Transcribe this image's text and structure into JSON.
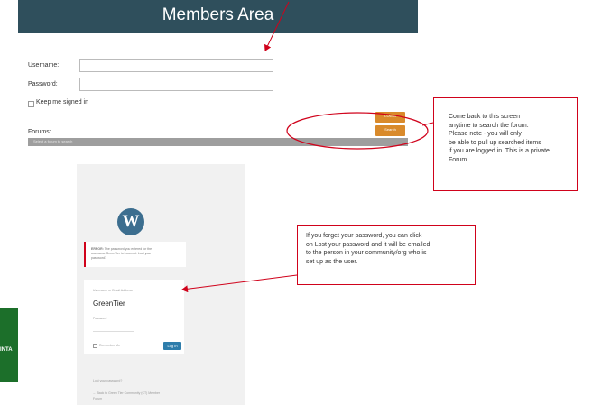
{
  "header": {
    "title": "Members Area"
  },
  "login_form": {
    "username_label": "Username:",
    "password_label": "Password:",
    "keep_signed_in_label": "Keep me signed in",
    "login_button": "LOGIN",
    "search_button": "Search"
  },
  "forums": {
    "label": "Forums:",
    "select_placeholder": "Select a forum to search"
  },
  "callout_search": {
    "lines": [
      "Come back to this screen",
      "anytime to search the forum.",
      "Please note - you will only",
      "be able to pull up searched items",
      "if you are logged in.  This is a private",
      "Forum."
    ]
  },
  "callout_password": {
    "lines": [
      "If you forget your password, you can click",
      "on Lost your password and it will be emailed",
      "to the person in your community/org who is",
      "set up as the user."
    ]
  },
  "wp_login": {
    "logo_letter": "W",
    "error_title": "ERROR:",
    "error_line1": "The password you entered for the",
    "error_line2": "username GreenTier is incorrect. Lost your",
    "error_line3": "password?",
    "username_label": "Username or Email Address",
    "username_value": "GreenTier",
    "password_label": "Password",
    "remember_label": "Remember Me",
    "login_button": "Log In",
    "lost_password_link": "Lost your password?",
    "back_link_line1": "← Back to Green Tier Community (CT) Member",
    "back_link_line2": "Forum"
  },
  "side_text": "INTA",
  "colors": {
    "header_bg": "#2f4f5c",
    "accent_orange": "#d98a2b",
    "annotation_red": "#d0021b",
    "wp_blue": "#2e7dab"
  }
}
